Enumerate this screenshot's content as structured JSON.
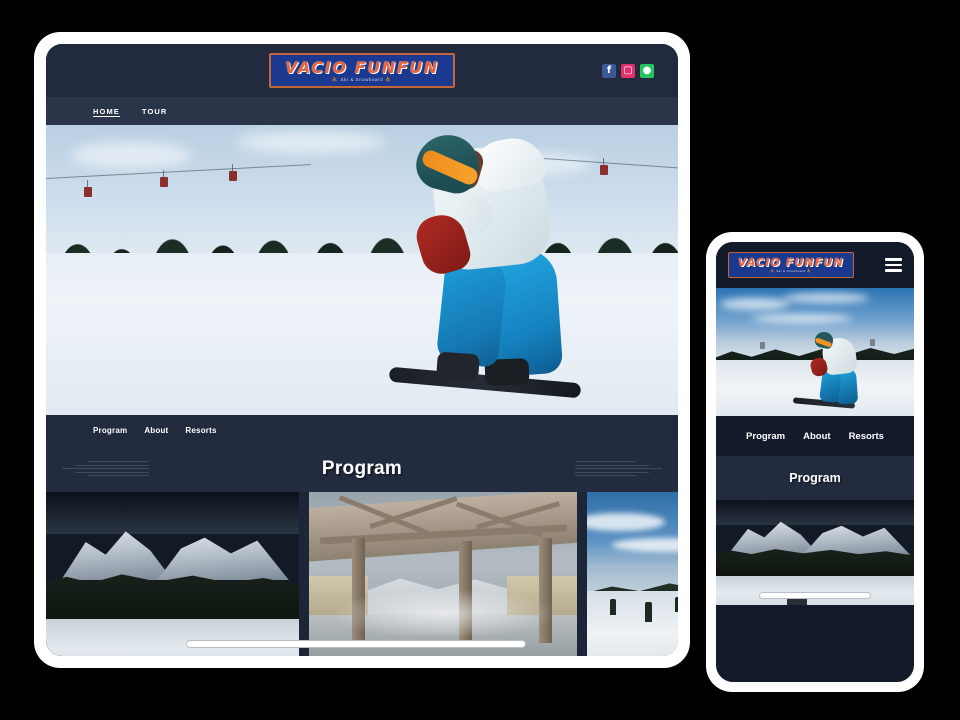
{
  "meta": {
    "page_background": "#000000",
    "device_frame_color": "#ffffff",
    "site_dark_navy": "#1d2639",
    "site_header_navy": "#212b3d",
    "accent_orange": "#e8643c",
    "logo_blue": "#1b3a8f",
    "logo_border": "#c4653a"
  },
  "desktop": {
    "header": {
      "logo": {
        "title": "VACIO FUNFUN",
        "subtitle": "Ski & Snowboard",
        "sled_glyph": "⛷"
      },
      "social": [
        {
          "name": "facebook",
          "glyph": "f",
          "color": "#3b5998"
        },
        {
          "name": "instagram",
          "glyph": "▢",
          "color": "#e1306c"
        },
        {
          "name": "line",
          "glyph": "●",
          "color": "#26c460"
        }
      ]
    },
    "main_nav": [
      {
        "label": "HOME",
        "active": true
      },
      {
        "label": "TOUR",
        "active": false
      }
    ],
    "hero": {
      "alt": "Snowboarder riding down a ski slope with chairlift and pine trees"
    },
    "sub_nav": [
      {
        "label": "Program"
      },
      {
        "label": "About"
      },
      {
        "label": "Resorts"
      }
    ],
    "program": {
      "title": "Program"
    },
    "gallery": [
      {
        "name": "snowy-mountain-range",
        "alt": "Snow covered mountain range at dusk"
      },
      {
        "name": "onsen-pavilion",
        "alt": "Wooden onsen pavilion with steaming hot spring in snow"
      },
      {
        "name": "ski-slope",
        "alt": "Ski slope with blue sky and winter trees"
      }
    ],
    "scrollbar": {
      "thumb_width_pct": 56
    }
  },
  "phone": {
    "header": {
      "logo": {
        "title": "VACIO FUNFUN",
        "subtitle": "Ski & Snowboard",
        "sled_glyph": "⛷"
      },
      "menu_button": "hamburger-menu"
    },
    "hero": {
      "alt": "Snowboarder riding down a ski slope under blue sky"
    },
    "nav": [
      {
        "label": "Program"
      },
      {
        "label": "About"
      },
      {
        "label": "Resorts"
      }
    ],
    "program": {
      "title": "Program"
    },
    "gallery": [
      {
        "name": "snowy-mountain-range",
        "alt": "Snow covered mountain range at dusk"
      }
    ],
    "scrollbar": {
      "thumb_width_pct": 64
    }
  }
}
